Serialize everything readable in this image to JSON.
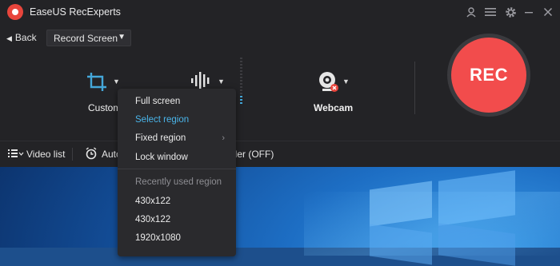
{
  "window": {
    "title": "EaseUS RecExperts"
  },
  "topbar": {
    "back_label": "Back",
    "mode_select": "Record Screen"
  },
  "controls": {
    "region_label": "Custom",
    "webcam_label": "Webcam",
    "rec_label": "REC"
  },
  "bottombar": {
    "video_list": "Video list",
    "auto_label": "Auto",
    "scheduler_label": "uler (OFF)"
  },
  "region_menu": {
    "items": [
      {
        "label": "Full screen"
      },
      {
        "label": "Select region"
      },
      {
        "label": "Fixed region"
      },
      {
        "label": "Lock window"
      }
    ],
    "recent_header": "Recently used region",
    "recent": [
      {
        "label": "430x122"
      },
      {
        "label": "430x122"
      },
      {
        "label": "1920x1080"
      }
    ]
  },
  "colors": {
    "accent": "#44a7d9",
    "selected_menu_item": "#4ab5ea",
    "rec_button": "#f24c4c",
    "background": "#232326"
  },
  "icons": [
    "app-logo-icon",
    "account-icon",
    "menu-icon",
    "settings-icon",
    "minimize-icon",
    "close-icon",
    "crop-icon",
    "audio-waveform-icon",
    "webcam-icon",
    "video-list-icon",
    "alarm-icon"
  ]
}
